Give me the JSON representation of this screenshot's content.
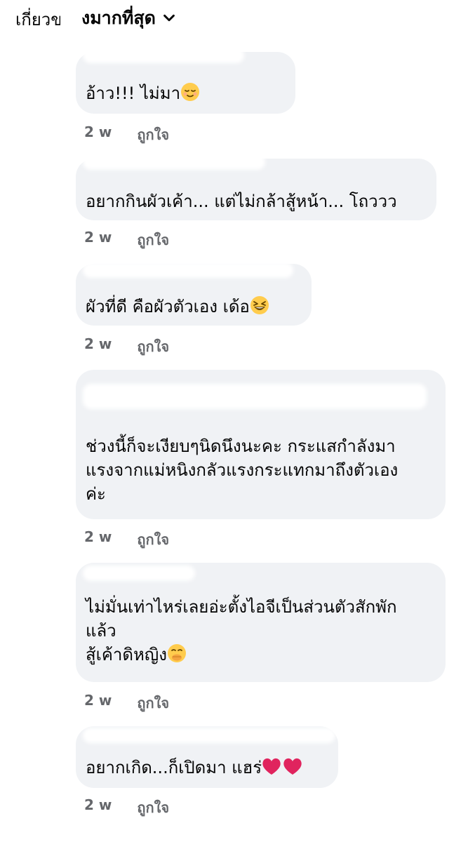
{
  "header": {
    "left_fragment": "เกี่ยวข",
    "sort_label": "งมากที่สุด"
  },
  "comments": [
    {
      "text": "อ้าว!!! ไม่มา",
      "emoji": "relieved-face-icon",
      "time": "2 w",
      "like": "ถูกใจ"
    },
    {
      "text": "อยากกินผัวเค้า... แต่ไม่กล้าสู้หน้า... โถววว",
      "time": "2 w",
      "like": "ถูกใจ"
    },
    {
      "text": "ผัวที่ดี คือผัวตัวเอง เด้อ",
      "emoji": "grinning-squinting-face-icon",
      "time": "2 w",
      "like": "ถูกใจ"
    },
    {
      "text": "ช่วงนี้ก็จะเงียบๆนิดนึงนะคะ กระแสกำลังมา\nแรงจากแม่หนิงกลัวแรงกระแทกมาถึงตัวเอง\nค่ะ",
      "time": "2 w",
      "like": "ถูกใจ"
    },
    {
      "text": "ไม่มั่นเท่าไหร่เลยอ่ะตั้งไอจีเป็นส่วนตัวสักพัก\nแล้ว\nสู้เค้าดิหญิง",
      "emoji": "face-with-hand-over-mouth-icon",
      "time": "2 w",
      "like": "ถูกใจ"
    },
    {
      "text": "อยากเกิด...ก็เปิดมา แฮร่",
      "emoji": "two-red-hearts-icon",
      "time": "2 w",
      "like": "ถูกใจ"
    }
  ],
  "colors": {
    "bubble": "#f0f2f5",
    "meta": "#65676b",
    "text": "#050505",
    "heart": "#e0245e",
    "emoji_face": "#ffcc4d"
  }
}
